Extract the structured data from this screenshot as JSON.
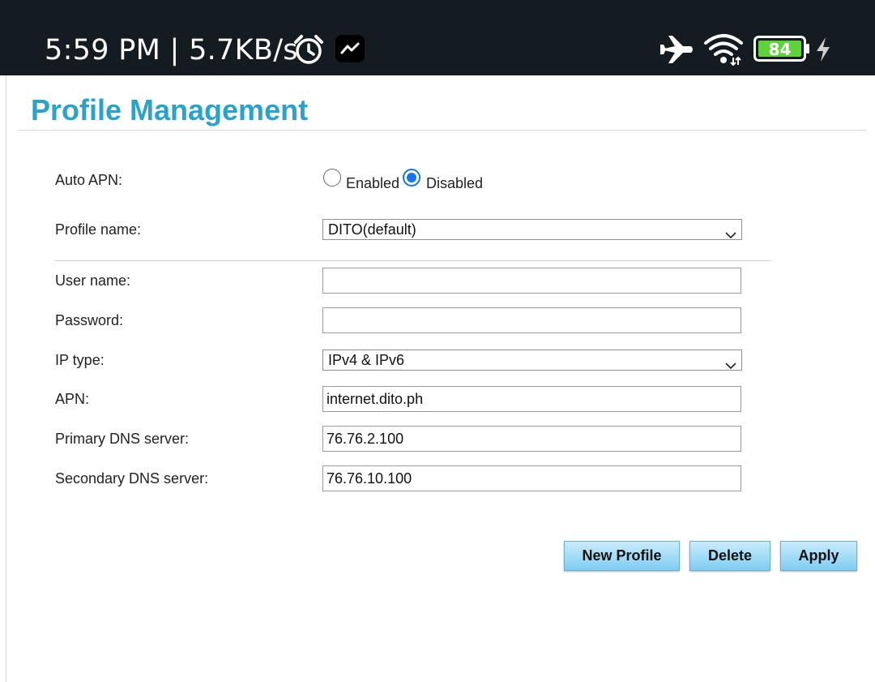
{
  "status_bar": {
    "time_speed": "5:59 PM | 5.7KB/s",
    "battery_level": "84",
    "icons": [
      "alarm-clock-icon",
      "messenger-icon",
      "airplane-mode-icon",
      "wifi-icon",
      "battery-icon",
      "charging-bolt-icon"
    ],
    "battery_color": "#5fd43a"
  },
  "page": {
    "title": "Profile Management",
    "accent_color": "#2aa3cc"
  },
  "form": {
    "auto_apn": {
      "label": "Auto APN:",
      "options": [
        "Enabled",
        "Disabled"
      ],
      "selected": "Disabled"
    },
    "profile_name": {
      "label": "Profile name:",
      "value": "DITO(default)"
    },
    "user_name": {
      "label": "User name:",
      "value": ""
    },
    "password": {
      "label": "Password:",
      "value": ""
    },
    "ip_type": {
      "label": "IP type:",
      "value": "IPv4 & IPv6"
    },
    "apn": {
      "label": "APN:",
      "value": "internet.dito.ph"
    },
    "primary_dns": {
      "label": "Primary DNS server:",
      "value": "76.76.2.100"
    },
    "secondary_dns": {
      "label": "Secondary DNS server:",
      "value": "76.76.10.100"
    }
  },
  "buttons": {
    "new_profile": "New Profile",
    "delete": "Delete",
    "apply": "Apply"
  }
}
